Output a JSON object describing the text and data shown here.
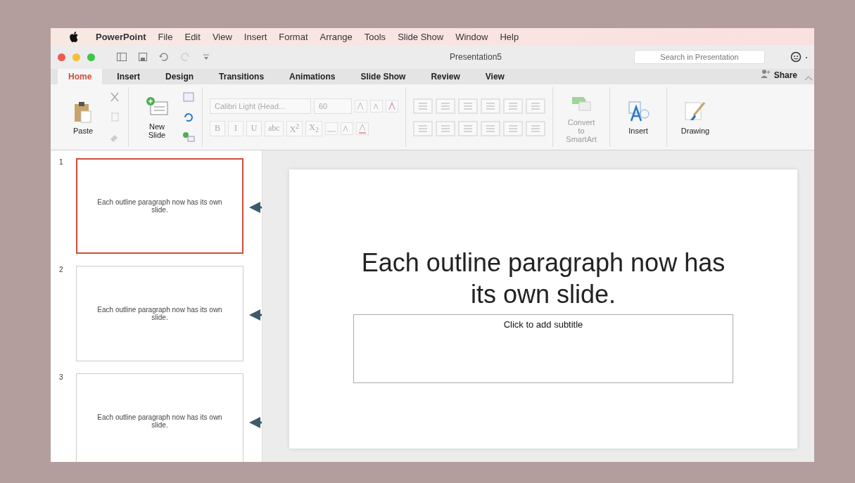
{
  "menu_bar": {
    "items": [
      {
        "label": "PowerPoint",
        "kind": "app"
      },
      {
        "label": "File",
        "kind": "menu"
      },
      {
        "label": "Edit",
        "kind": "menu"
      },
      {
        "label": "View",
        "kind": "menu"
      },
      {
        "label": "Insert",
        "kind": "menu"
      },
      {
        "label": "Format",
        "kind": "menu"
      },
      {
        "label": "Arrange",
        "kind": "menu"
      },
      {
        "label": "Tools",
        "kind": "menu"
      },
      {
        "label": "Slide Show",
        "kind": "menu"
      },
      {
        "label": "Window",
        "kind": "menu"
      },
      {
        "label": "Help",
        "kind": "menu"
      }
    ]
  },
  "window": {
    "title": "Presentation5"
  },
  "search": {
    "placeholder": "Search in Presentation"
  },
  "tabs": [
    {
      "label": "Home",
      "selected": true
    },
    {
      "label": "Insert",
      "selected": false
    },
    {
      "label": "Design",
      "selected": false
    },
    {
      "label": "Transitions",
      "selected": false
    },
    {
      "label": "Animations",
      "selected": false
    },
    {
      "label": "Slide Show",
      "selected": false
    },
    {
      "label": "Review",
      "selected": false
    },
    {
      "label": "View",
      "selected": false
    }
  ],
  "share": {
    "label": "Share"
  },
  "ribbon": {
    "paste": "Paste",
    "new_slide": "New Slide",
    "font_name": "Calibri Light (Head...",
    "font_size": "60",
    "format_buttons": [
      "B",
      "I",
      "U",
      "abc",
      "X$^{2}$",
      "X$_{2}$"
    ],
    "convert": "Convert to SmartArt",
    "insert": "Insert",
    "drawing": "Drawing"
  },
  "slides": [
    {
      "number": "1",
      "text": "Each outline paragraph now has its own slide.",
      "selected": true
    },
    {
      "number": "2",
      "text": "Each outline paragraph now has its own slide.",
      "selected": false
    },
    {
      "number": "3",
      "text": "Each outline paragraph now has its own slide.",
      "selected": false
    }
  ],
  "editor": {
    "title": "Each outline paragraph now has its own slide.",
    "subtitle_placeholder": "Click to add subtitle"
  }
}
